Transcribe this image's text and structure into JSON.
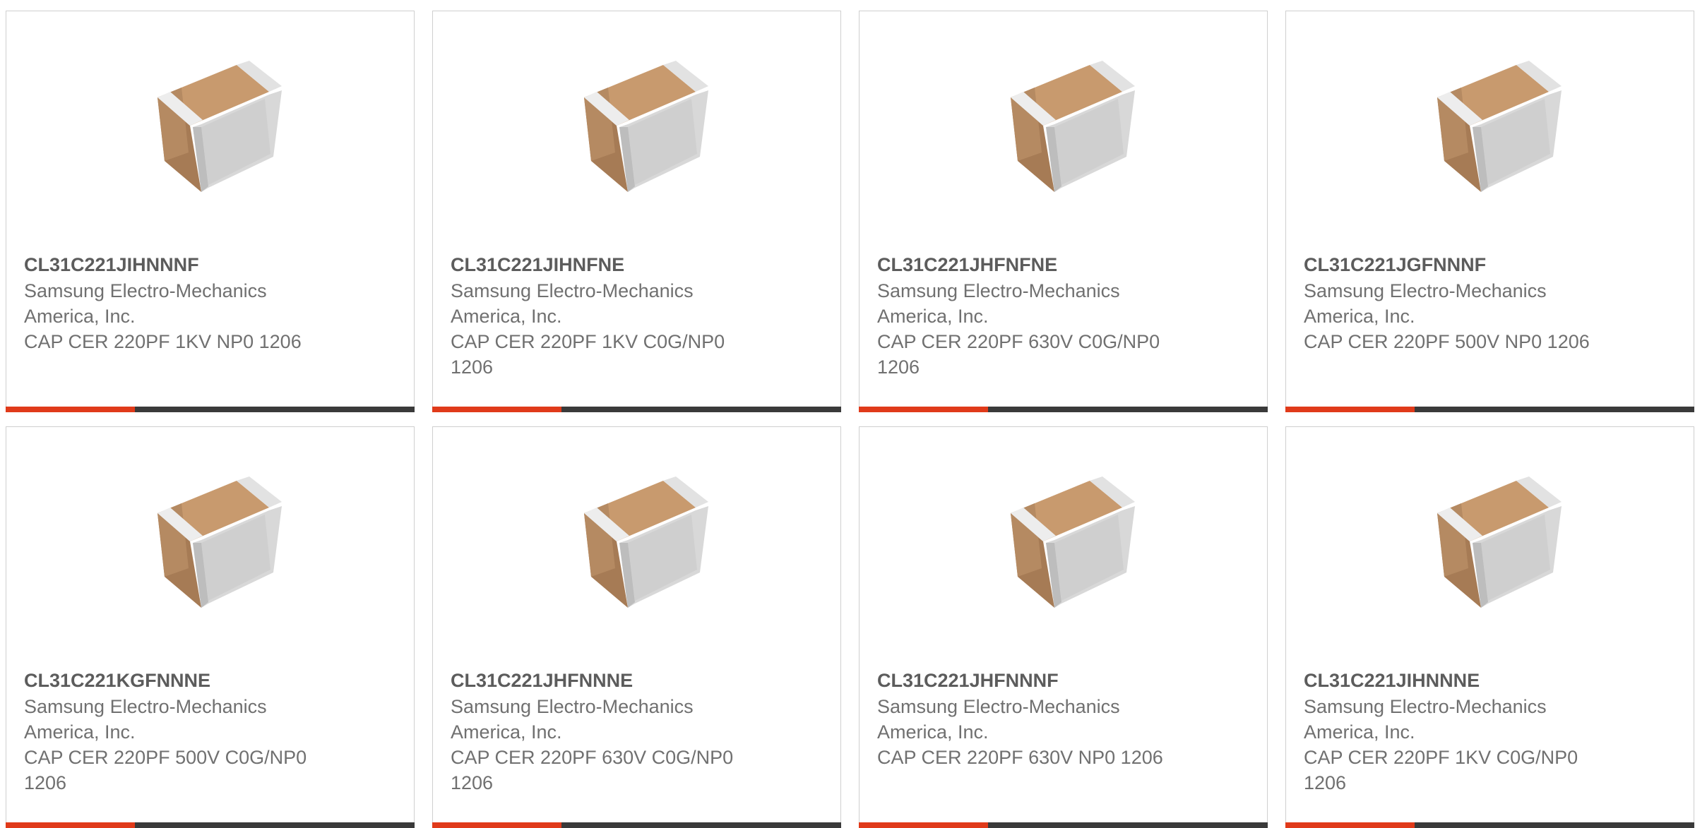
{
  "products": [
    {
      "part_number": "CL31C221JIHNNNF",
      "manufacturer": "Samsung Electro-Mechanics America, Inc.",
      "description": "CAP CER 220PF 1KV NP0 1206"
    },
    {
      "part_number": "CL31C221JIHNFNE",
      "manufacturer": "Samsung Electro-Mechanics America, Inc.",
      "description": "CAP CER 220PF 1KV C0G/NP0 1206"
    },
    {
      "part_number": "CL31C221JHFNFNE",
      "manufacturer": "Samsung Electro-Mechanics America, Inc.",
      "description": "CAP CER 220PF 630V C0G/NP0 1206"
    },
    {
      "part_number": "CL31C221JGFNNNF",
      "manufacturer": "Samsung Electro-Mechanics America, Inc.",
      "description": "CAP CER 220PF 500V NP0 1206"
    },
    {
      "part_number": "CL31C221KGFNNNE",
      "manufacturer": "Samsung Electro-Mechanics America, Inc.",
      "description": "CAP CER 220PF 500V C0G/NP0 1206"
    },
    {
      "part_number": "CL31C221JHFNNNE",
      "manufacturer": "Samsung Electro-Mechanics America, Inc.",
      "description": "CAP CER 220PF 630V C0G/NP0 1206"
    },
    {
      "part_number": "CL31C221JHFNNNF",
      "manufacturer": "Samsung Electro-Mechanics America, Inc.",
      "description": "CAP CER 220PF 630V NP0 1206"
    },
    {
      "part_number": "CL31C221JIHNNNE",
      "manufacturer": "Samsung Electro-Mechanics America, Inc.",
      "description": "CAP CER 220PF 1KV C0G/NP0 1206"
    }
  ],
  "image_icon": "ceramic-capacitor-chip-icon",
  "colors": {
    "accent": "#e03a1a",
    "bar": "#3a3a3a",
    "border": "#cfcfcf",
    "text": "#707070",
    "chip_body": "#b58a62",
    "chip_terminal": "#d4d4d4"
  }
}
